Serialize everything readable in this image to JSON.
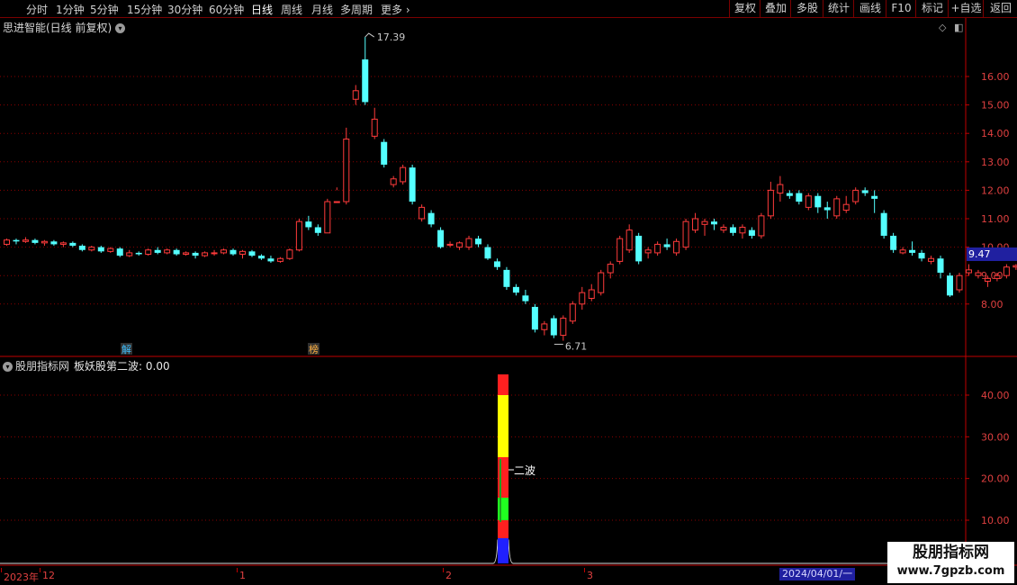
{
  "toolbar": {
    "periods": [
      "分时",
      "1分钟",
      "5分钟",
      "15分钟",
      "30分钟",
      "60分钟",
      "日线",
      "周线",
      "月线",
      "多周期",
      "更多"
    ],
    "active_period": "日线",
    "right_buttons": [
      "复权",
      "叠加",
      "多股",
      "统计",
      "画线",
      "F10",
      "标记",
      "+自选",
      "返回"
    ]
  },
  "main": {
    "title": "思进智能(日线 前复权)",
    "high_label": "17.39",
    "low_label": "6.71",
    "current_price": "9.47",
    "markers": [
      {
        "text": "解",
        "color": "#40c0ff"
      },
      {
        "text": "榜",
        "color": "#ffb040"
      }
    ],
    "y_ticks": [
      "16.00",
      "15.00",
      "14.00",
      "13.00",
      "12.00",
      "11.00",
      "10.00",
      "9.00",
      "8.00"
    ]
  },
  "indicator": {
    "name": "股朋指标网",
    "line": "板妖股第二波: 0.00",
    "signal_label": "二波",
    "y_ticks": [
      "40.00",
      "30.00",
      "20.00",
      "10.00"
    ]
  },
  "date_axis": {
    "labels": [
      "2023年",
      "12",
      "1",
      "2",
      "3"
    ],
    "cursor_date": "2024/04/01/一"
  },
  "watermark": {
    "title": "股朋指标网",
    "url": "www.7gpzb.com"
  },
  "colors": {
    "up": "#ff3b3b",
    "down": "#54ffff",
    "axis": "#c00000",
    "grid": "#8a0000"
  },
  "candles": [
    [
      10.1,
      10.25,
      10.3,
      10.05
    ],
    [
      10.25,
      10.2,
      10.3,
      10.1
    ],
    [
      10.2,
      10.25,
      10.35,
      10.15
    ],
    [
      10.25,
      10.15,
      10.3,
      10.1
    ],
    [
      10.15,
      10.2,
      10.25,
      10.05
    ],
    [
      10.2,
      10.1,
      10.25,
      10.05
    ],
    [
      10.1,
      10.15,
      10.2,
      10.0
    ],
    [
      10.15,
      10.05,
      10.2,
      10.0
    ],
    [
      10.05,
      9.9,
      10.1,
      9.85
    ],
    [
      9.9,
      10.0,
      10.05,
      9.85
    ],
    [
      10.0,
      9.85,
      10.05,
      9.8
    ],
    [
      9.85,
      9.95,
      10.0,
      9.8
    ],
    [
      9.95,
      9.7,
      10.0,
      9.65
    ],
    [
      9.7,
      9.8,
      9.9,
      9.65
    ],
    [
      9.8,
      9.75,
      9.85,
      9.7
    ],
    [
      9.75,
      9.9,
      9.95,
      9.7
    ],
    [
      9.9,
      9.8,
      10.0,
      9.75
    ],
    [
      9.8,
      9.9,
      9.95,
      9.75
    ],
    [
      9.9,
      9.75,
      9.95,
      9.7
    ],
    [
      9.75,
      9.8,
      9.85,
      9.7
    ],
    [
      9.8,
      9.7,
      9.85,
      9.6
    ],
    [
      9.7,
      9.8,
      9.85,
      9.65
    ],
    [
      9.8,
      9.8,
      9.9,
      9.7
    ],
    [
      9.8,
      9.9,
      9.95,
      9.75
    ],
    [
      9.9,
      9.75,
      9.95,
      9.7
    ],
    [
      9.75,
      9.85,
      9.9,
      9.6
    ],
    [
      9.85,
      9.7,
      9.9,
      9.65
    ],
    [
      9.7,
      9.6,
      9.75,
      9.55
    ],
    [
      9.6,
      9.5,
      9.7,
      9.45
    ],
    [
      9.5,
      9.6,
      9.65,
      9.45
    ],
    [
      9.6,
      9.9,
      9.95,
      9.55
    ],
    [
      9.9,
      10.9,
      11.0,
      9.85
    ],
    [
      10.9,
      10.7,
      11.1,
      10.6
    ],
    [
      10.7,
      10.5,
      10.8,
      10.4
    ],
    [
      10.5,
      11.6,
      11.7,
      10.5
    ],
    [
      11.6,
      11.6,
      12.1,
      12.0
    ],
    [
      11.6,
      13.8,
      14.2,
      11.5
    ],
    [
      15.2,
      15.5,
      15.7,
      15.0
    ],
    [
      16.6,
      15.1,
      17.39,
      15.0
    ],
    [
      13.9,
      14.5,
      14.9,
      13.8
    ],
    [
      13.7,
      12.9,
      13.8,
      12.8
    ],
    [
      12.2,
      12.4,
      12.5,
      12.1
    ],
    [
      12.3,
      12.8,
      12.9,
      12.2
    ],
    [
      12.8,
      11.6,
      12.9,
      11.5
    ],
    [
      11.0,
      11.4,
      11.5,
      10.9
    ],
    [
      11.2,
      10.8,
      11.3,
      10.7
    ],
    [
      10.6,
      10.0,
      10.7,
      9.95
    ],
    [
      10.1,
      10.1,
      10.2,
      10.0
    ],
    [
      10.0,
      10.15,
      10.2,
      9.9
    ],
    [
      10.0,
      10.3,
      10.4,
      9.9
    ],
    [
      10.3,
      10.1,
      10.4,
      10.0
    ],
    [
      10.0,
      9.6,
      10.1,
      9.55
    ],
    [
      9.5,
      9.3,
      9.6,
      9.2
    ],
    [
      9.2,
      8.6,
      9.3,
      8.5
    ],
    [
      8.6,
      8.4,
      8.7,
      8.3
    ],
    [
      8.3,
      8.1,
      8.5,
      8.0
    ],
    [
      7.9,
      7.1,
      8.0,
      7.0
    ],
    [
      7.1,
      7.3,
      7.4,
      6.9
    ],
    [
      7.5,
      6.9,
      7.6,
      6.8
    ],
    [
      6.9,
      7.5,
      7.6,
      6.71
    ],
    [
      7.4,
      8.0,
      8.1,
      7.3
    ],
    [
      8.0,
      8.4,
      8.6,
      7.8
    ],
    [
      8.2,
      8.5,
      8.7,
      8.1
    ],
    [
      8.4,
      9.1,
      9.2,
      8.3
    ],
    [
      9.1,
      9.4,
      9.5,
      8.9
    ],
    [
      9.5,
      10.3,
      10.4,
      9.4
    ],
    [
      9.9,
      10.6,
      10.8,
      9.8
    ],
    [
      10.4,
      9.5,
      10.5,
      9.4
    ],
    [
      9.8,
      9.9,
      10.0,
      9.6
    ],
    [
      9.8,
      10.1,
      10.2,
      9.7
    ],
    [
      10.1,
      10.0,
      10.3,
      9.9
    ],
    [
      9.8,
      10.2,
      10.3,
      9.7
    ],
    [
      10.0,
      10.9,
      11.0,
      9.9
    ],
    [
      10.6,
      11.0,
      11.2,
      10.5
    ],
    [
      10.8,
      10.9,
      11.0,
      10.4
    ],
    [
      10.9,
      10.8,
      11.0,
      10.6
    ],
    [
      10.6,
      10.7,
      10.8,
      10.5
    ],
    [
      10.7,
      10.5,
      10.8,
      10.4
    ],
    [
      10.5,
      10.7,
      10.8,
      10.3
    ],
    [
      10.6,
      10.4,
      10.7,
      10.3
    ],
    [
      10.4,
      11.1,
      11.2,
      10.3
    ],
    [
      11.1,
      12.0,
      12.3,
      11.0
    ],
    [
      11.9,
      12.2,
      12.5,
      11.6
    ],
    [
      11.9,
      11.8,
      12.0,
      11.7
    ],
    [
      11.9,
      11.6,
      12.0,
      11.5
    ],
    [
      11.4,
      11.8,
      11.9,
      11.3
    ],
    [
      11.8,
      11.4,
      11.9,
      11.2
    ],
    [
      11.4,
      11.3,
      11.6,
      11.0
    ],
    [
      11.1,
      11.7,
      11.8,
      11.0
    ],
    [
      11.3,
      11.5,
      11.8,
      11.2
    ],
    [
      11.6,
      12.0,
      12.1,
      11.5
    ],
    [
      12.0,
      11.9,
      12.1,
      11.8
    ],
    [
      11.8,
      11.7,
      12.0,
      11.2
    ],
    [
      11.2,
      10.4,
      11.3,
      10.3
    ],
    [
      10.4,
      9.9,
      10.5,
      9.8
    ],
    [
      9.8,
      9.9,
      10.0,
      9.75
    ],
    [
      9.9,
      9.8,
      10.2,
      9.7
    ],
    [
      9.8,
      9.6,
      9.9,
      9.5
    ],
    [
      9.5,
      9.6,
      9.7,
      9.4
    ],
    [
      9.6,
      9.1,
      9.7,
      8.9
    ],
    [
      9.0,
      8.3,
      9.1,
      8.25
    ],
    [
      8.5,
      9.0,
      9.1,
      8.4
    ],
    [
      9.1,
      9.2,
      9.4,
      9.0
    ],
    [
      9.0,
      9.1,
      9.2,
      8.9
    ],
    [
      8.8,
      8.9,
      9.0,
      8.6
    ],
    [
      8.9,
      9.0,
      9.1,
      8.8
    ],
    [
      9.0,
      9.3,
      9.4,
      8.9
    ],
    [
      9.3,
      9.35,
      9.4,
      9.2
    ],
    [
      9.4,
      9.5,
      9.55,
      9.3
    ],
    [
      9.7,
      10.3,
      10.4,
      9.6
    ],
    [
      10.3,
      10.6,
      10.8,
      10.2
    ]
  ]
}
